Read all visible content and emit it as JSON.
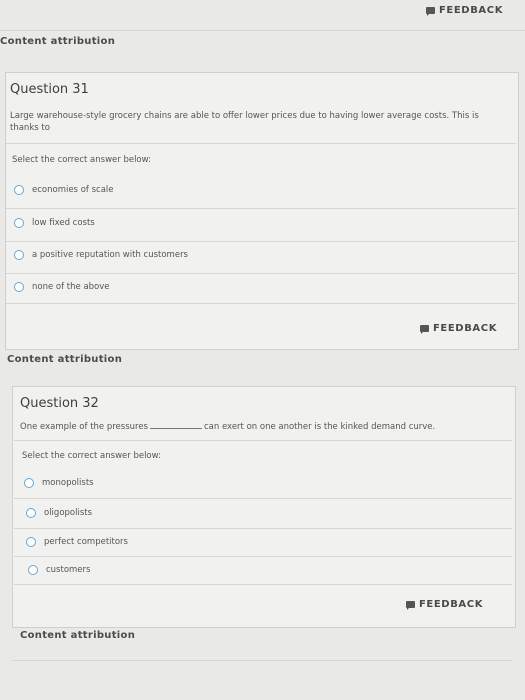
{
  "top": {
    "feedback_label": "FEEDBACK",
    "content_attribution": "Content attribution"
  },
  "q31": {
    "title": "Question 31",
    "text": "Large warehouse-style grocery chains are able to offer lower prices due to having lower average costs. This is thanks to",
    "select_prompt": "Select the correct answer below:",
    "options": [
      {
        "label": "economies of scale"
      },
      {
        "label": "low fixed costs"
      },
      {
        "label": "a positive reputation with customers"
      },
      {
        "label": "none of the above"
      }
    ],
    "feedback_label": "FEEDBACK",
    "content_attribution": "Content attribution"
  },
  "q32": {
    "title": "Question 32",
    "text_before": "One example of the pressures",
    "text_after": "can exert on one another is the kinked demand curve.",
    "select_prompt": "Select the correct answer below:",
    "options": [
      {
        "label": "monopolists"
      },
      {
        "label": "oligopolists"
      },
      {
        "label": "perfect competitors"
      },
      {
        "label": "customers"
      }
    ],
    "feedback_label": "FEEDBACK",
    "content_attribution": "Content attribution"
  }
}
